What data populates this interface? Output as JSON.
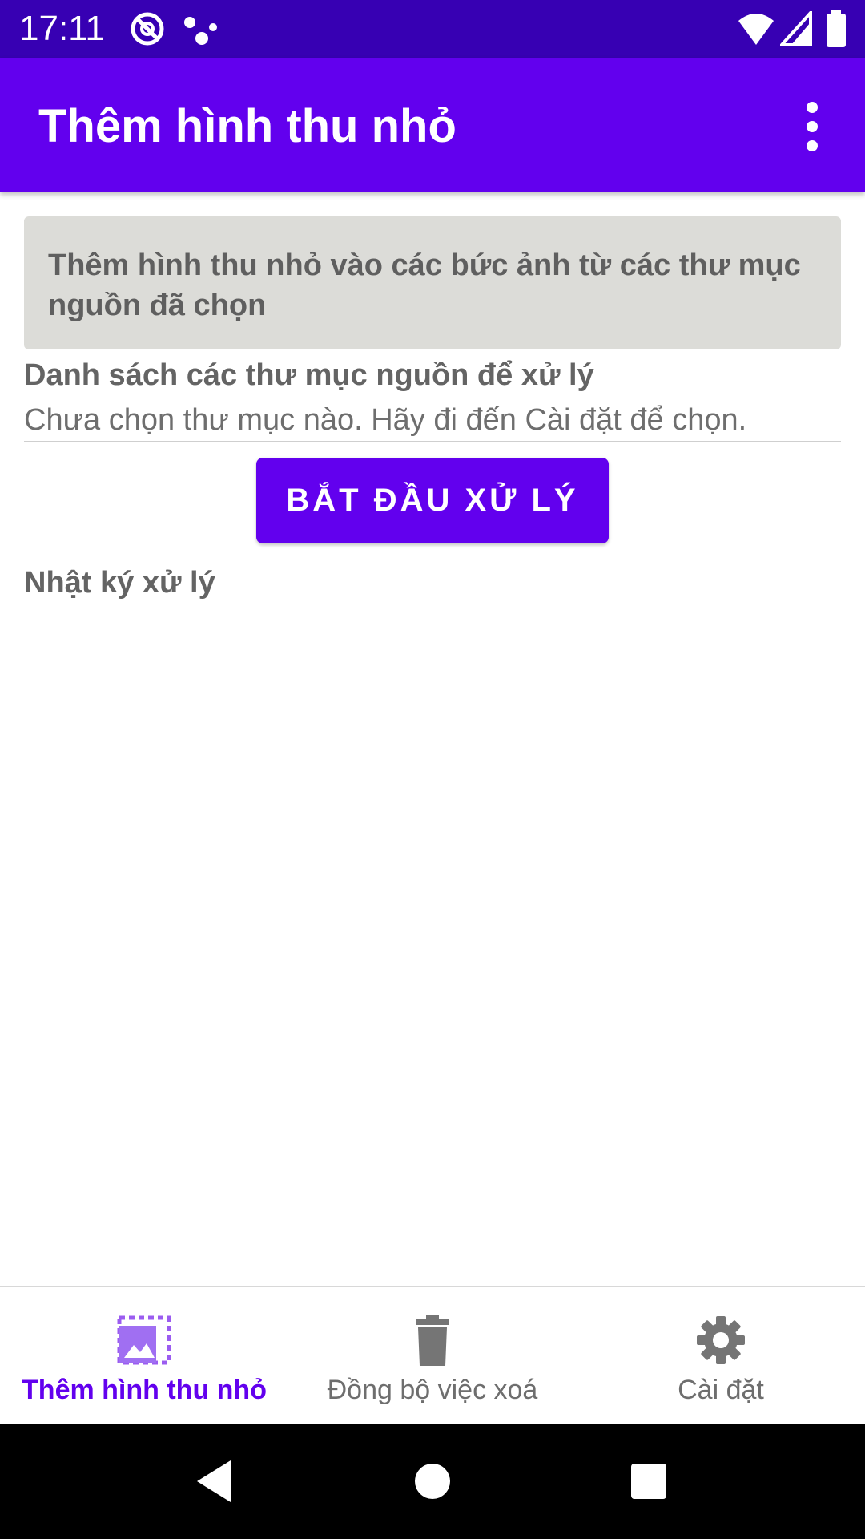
{
  "status_bar": {
    "time": "17:11",
    "icons": [
      "vpn-icon",
      "dots-icon",
      "wifi-icon",
      "signal-icon",
      "battery-icon"
    ]
  },
  "app_bar": {
    "title": "Thêm hình thu nhỏ",
    "overflow_icon": "more-vert-icon"
  },
  "content": {
    "description": "Thêm hình thu nhỏ vào các bức ảnh từ các thư mục nguồn đã chọn",
    "source_section_title": "Danh sách các thư mục nguồn để xử lý",
    "source_status": "Chưa chọn thư mục nào. Hãy đi đến Cài đặt để chọn.",
    "start_button_label": "BẮT ĐẦU XỬ LÝ",
    "log_title": "Nhật ký xử lý"
  },
  "bottom_nav": {
    "items": [
      {
        "label": "Thêm hình thu nhỏ",
        "icon": "thumbnail-image-icon",
        "active": true
      },
      {
        "label": "Đồng bộ việc xoá",
        "icon": "trash-icon",
        "active": false
      },
      {
        "label": "Cài đặt",
        "icon": "settings-gear-icon",
        "active": false
      }
    ]
  },
  "system_nav": {
    "buttons": [
      "back-icon",
      "home-icon",
      "recents-icon"
    ]
  },
  "colors": {
    "primary": "#6200ee",
    "primary_dark": "#3700b3",
    "inactive": "#6e6e6e",
    "card_background": "#dcdcd8"
  }
}
